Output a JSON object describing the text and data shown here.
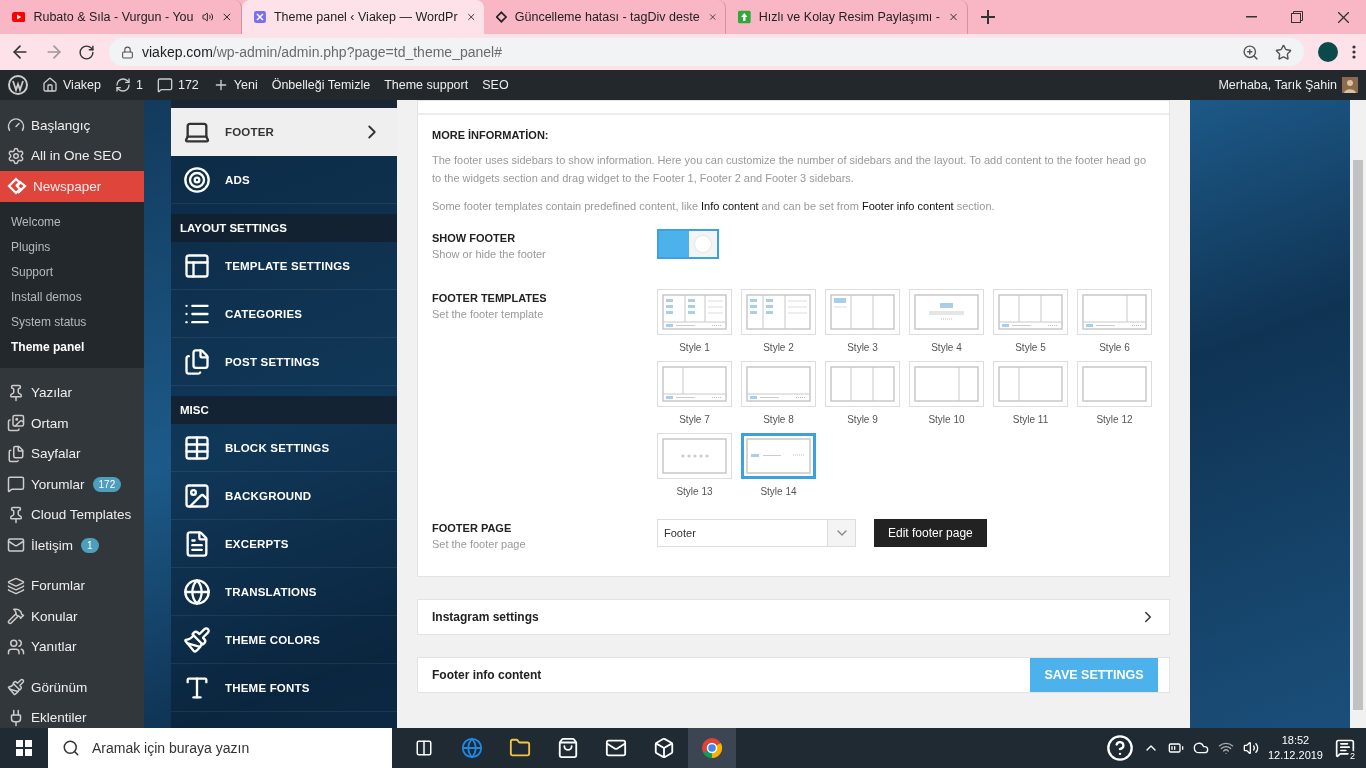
{
  "browser": {
    "tabs": [
      {
        "title": "Rubato & Sıla - Vurgun - You",
        "selected": false
      },
      {
        "title": "Theme panel ‹ Viakep — WordPr",
        "selected": true
      },
      {
        "title": "Güncelleme hatası - tagDiv deste",
        "selected": false
      },
      {
        "title": "Hızlı ve Kolay Resim Paylaşımı -",
        "selected": false
      }
    ],
    "url_host": "viakep.com",
    "url_path": "/wp-admin/admin.php?page=td_theme_panel#"
  },
  "admin_bar": {
    "site": "Viakep",
    "updates": "1",
    "comments": "172",
    "new": "Yeni",
    "links": [
      "Önbelleği Temizle",
      "Theme support",
      "SEO"
    ],
    "greeting": "Merhaba, Tarık Şahin"
  },
  "wp_menu": {
    "groups": [
      [
        {
          "label": "Başlangıç",
          "selected": false
        },
        {
          "label": "All in One SEO",
          "selected": false
        },
        {
          "label": "Newspaper",
          "selected": true,
          "children": [
            {
              "label": "Welcome",
              "selected": false
            },
            {
              "label": "Plugins",
              "selected": false
            },
            {
              "label": "Support",
              "selected": false
            },
            {
              "label": "Install demos",
              "selected": false
            },
            {
              "label": "System status",
              "selected": false
            },
            {
              "label": "Theme panel",
              "selected": true
            }
          ]
        }
      ],
      [
        {
          "label": "Yazılar",
          "selected": false
        },
        {
          "label": "Ortam",
          "selected": false
        },
        {
          "label": "Sayfalar",
          "selected": false
        },
        {
          "label": "Yorumlar",
          "selected": false,
          "badge": "172"
        },
        {
          "label": "Cloud Templates",
          "selected": false
        },
        {
          "label": "İletişim",
          "selected": false,
          "badge": "1"
        }
      ],
      [
        {
          "label": "Forumlar",
          "selected": false
        },
        {
          "label": "Konular",
          "selected": false
        },
        {
          "label": "Yanıtlar",
          "selected": false
        }
      ],
      [
        {
          "label": "Görünüm",
          "selected": false
        },
        {
          "label": "Eklentiler",
          "selected": false
        }
      ]
    ]
  },
  "theme_nav": [
    {
      "kind": "item",
      "label": "FOOTER",
      "selected": true
    },
    {
      "kind": "item",
      "label": "ADS",
      "selected": false
    },
    {
      "kind": "header",
      "label": "LAYOUT SETTINGS"
    },
    {
      "kind": "item",
      "label": "TEMPLATE SETTINGS",
      "selected": false
    },
    {
      "kind": "item",
      "label": "CATEGORIES",
      "selected": false
    },
    {
      "kind": "item",
      "label": "POST SETTINGS",
      "selected": false
    },
    {
      "kind": "header",
      "label": "MISC"
    },
    {
      "kind": "item",
      "label": "BLOCK SETTINGS",
      "selected": false
    },
    {
      "kind": "item",
      "label": "BACKGROUND",
      "selected": false
    },
    {
      "kind": "item",
      "label": "EXCERPTS",
      "selected": false
    },
    {
      "kind": "item",
      "label": "TRANSLATIONS",
      "selected": false
    },
    {
      "kind": "item",
      "label": "THEME COLORS",
      "selected": false
    },
    {
      "kind": "item",
      "label": "THEME FONTS",
      "selected": false
    }
  ],
  "panel": {
    "info_title": "MORE İNFORMATİON:",
    "paragraphs": [
      "The footer uses sidebars to show information. Here you can customize the number of sidebars and the layout. To add content to the footer head go to the widgets section and drag widget to the Footer 1, Footer 2 and Footer 3 sidebars.",
      "Some footer templates contain predefined content, like **Info content** and can be set from **Footer info content** section."
    ],
    "show_footer": {
      "label": "SHOW FOOTER",
      "hint": "Show or hide the footer",
      "on": true
    },
    "templates": {
      "label": "FOOTER TEMPLATES",
      "hint": "Set the footer template",
      "items": [
        {
          "label": "Style 1",
          "kind": "grid-bar",
          "selected": false
        },
        {
          "label": "Style 2",
          "kind": "grid",
          "selected": false
        },
        {
          "label": "Style 3",
          "kind": "cols3-top",
          "selected": false
        },
        {
          "label": "Style 4",
          "kind": "centered",
          "selected": false
        },
        {
          "label": "Style 5",
          "kind": "cols3-bar",
          "selected": false
        },
        {
          "label": "Style 6",
          "kind": "cols2r-bar",
          "selected": false
        },
        {
          "label": "Style 7",
          "kind": "cols2l-bar",
          "selected": false
        },
        {
          "label": "Style 8",
          "kind": "cols1-bar",
          "selected": false
        },
        {
          "label": "Style 9",
          "kind": "cols3",
          "selected": false
        },
        {
          "label": "Style 10",
          "kind": "cols2r",
          "selected": false
        },
        {
          "label": "Style 11",
          "kind": "cols2l",
          "selected": false
        },
        {
          "label": "Style 12",
          "kind": "cols1",
          "selected": false
        },
        {
          "label": "Style 13",
          "kind": "dots",
          "selected": false
        },
        {
          "label": "Style 14",
          "kind": "bar",
          "selected": true
        }
      ]
    },
    "footer_page": {
      "label": "FOOTER PAGE",
      "hint": "Set the footer page",
      "value": "Footer",
      "button": "Edit footer page"
    }
  },
  "sections": [
    {
      "title": "Instagram settings",
      "expandable": true
    },
    {
      "title": "Footer info content",
      "expandable": false
    }
  ],
  "save_button": "SAVE SETTINGS",
  "taskbar": {
    "search_placeholder": "Aramak için buraya yazın",
    "time": "18:52",
    "date": "12.12.2019",
    "notifications": "2"
  }
}
